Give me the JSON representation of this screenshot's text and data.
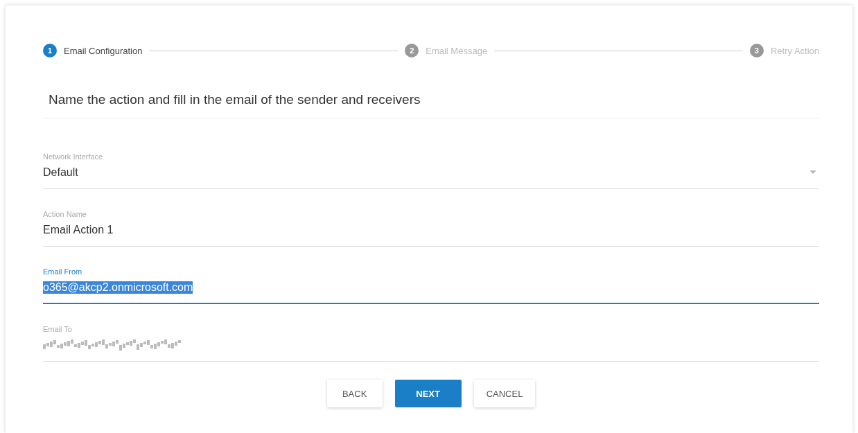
{
  "stepper": [
    {
      "number": "1",
      "label": "Email Configuration",
      "selected": true
    },
    {
      "number": "2",
      "label": "Email Message",
      "selected": false
    },
    {
      "number": "3",
      "label": "Retry Action",
      "selected": false
    }
  ],
  "heading": "Name the action and fill in the email of the sender and receivers",
  "fields": [
    {
      "kind": "select",
      "label": "Network Interface",
      "value": "Default",
      "focused": false,
      "text_selected": false
    },
    {
      "kind": "text",
      "label": "Action Name",
      "value": "Email Action 1",
      "focused": false,
      "text_selected": false
    },
    {
      "kind": "text",
      "label": "Email From",
      "value": "o365@akcp2.onmicrosoft.com",
      "focused": true,
      "text_selected": true
    },
    {
      "kind": "obscured",
      "label": "Email To",
      "focused": false
    }
  ],
  "buttons": [
    {
      "label": "BACK",
      "kind": "flat"
    },
    {
      "label": "NEXT",
      "kind": "primary"
    },
    {
      "label": "CANCEL",
      "kind": "flat"
    }
  ]
}
